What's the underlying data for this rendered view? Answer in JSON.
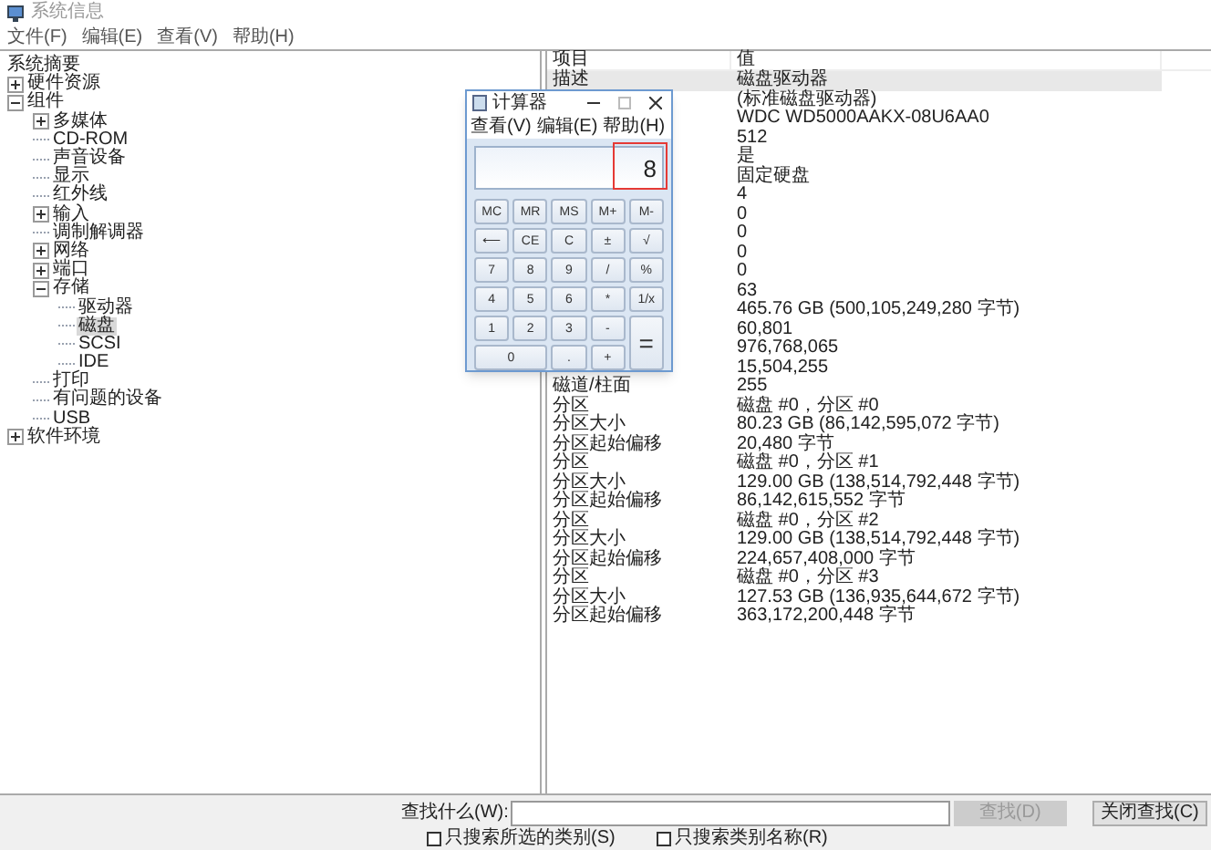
{
  "window": {
    "title": "系统信息"
  },
  "menu": [
    "文件(F)",
    "编辑(E)",
    "查看(V)",
    "帮助(H)"
  ],
  "tree": [
    {
      "label": "系统摘要",
      "selected": false,
      "children": [
        {
          "label": "硬件资源",
          "expanded": false,
          "selected": false
        },
        {
          "label": "组件",
          "expanded": true,
          "selected": false,
          "children": [
            {
              "label": "多媒体",
              "expanded": false,
              "selected": false
            },
            {
              "label": "CD-ROM",
              "selected": false
            },
            {
              "label": "声音设备",
              "selected": false
            },
            {
              "label": "显示",
              "selected": false
            },
            {
              "label": "红外线",
              "selected": false
            },
            {
              "label": "输入",
              "expanded": false,
              "selected": false
            },
            {
              "label": "调制解调器",
              "selected": false
            },
            {
              "label": "网络",
              "expanded": false,
              "selected": false
            },
            {
              "label": "端口",
              "expanded": false,
              "selected": false
            },
            {
              "label": "存储",
              "expanded": true,
              "selected": false,
              "children": [
                {
                  "label": "驱动器",
                  "selected": false
                },
                {
                  "label": "磁盘",
                  "selected": true
                },
                {
                  "label": "SCSI",
                  "selected": false
                },
                {
                  "label": "IDE",
                  "selected": false
                }
              ]
            },
            {
              "label": "打印",
              "selected": false
            },
            {
              "label": "有问题的设备",
              "selected": false
            },
            {
              "label": "USB",
              "selected": false
            }
          ]
        },
        {
          "label": "软件环境",
          "expanded": false,
          "selected": false
        }
      ]
    }
  ],
  "table": {
    "columns": [
      "项目",
      "值"
    ],
    "rows": [
      {
        "item": "描述",
        "value": "磁盘驱动器",
        "selected": true
      },
      {
        "value": "(标准磁盘驱动器)",
        "selected": false
      },
      {
        "value": "WDC WD5000AAKX-08U6AA0",
        "selected": false
      },
      {
        "value": "512",
        "selected": false
      },
      {
        "value": "是",
        "selected": false
      },
      {
        "value": "固定硬盘",
        "selected": false
      },
      {
        "value": "4",
        "selected": false
      },
      {
        "value": "0",
        "selected": false
      },
      {
        "value": "0",
        "selected": false
      },
      {
        "value": "0",
        "selected": false
      },
      {
        "value": "0",
        "selected": false
      },
      {
        "value": "63",
        "selected": false
      },
      {
        "value": "465.76 GB (500,105,249,280 字节)",
        "selected": false
      },
      {
        "value": "60,801",
        "selected": false
      },
      {
        "value": "976,768,065",
        "selected": false
      },
      {
        "value": "15,504,255",
        "selected": false
      },
      {
        "item": "磁道/柱面",
        "value": "255",
        "selected": false
      },
      {
        "item": "分区",
        "value": "磁盘 #0，分区 #0",
        "selected": false
      },
      {
        "item": "分区大小",
        "value": "80.23 GB (86,142,595,072 字节)",
        "selected": false
      },
      {
        "item": "分区起始偏移",
        "value": "20,480 字节",
        "selected": false
      },
      {
        "item": "分区",
        "value": "磁盘 #0，分区 #1",
        "selected": false
      },
      {
        "item": "分区大小",
        "value": "129.00 GB (138,514,792,448 字节)",
        "selected": false
      },
      {
        "item": "分区起始偏移",
        "value": "86,142,615,552 字节",
        "selected": false
      },
      {
        "item": "分区",
        "value": "磁盘 #0，分区 #2",
        "selected": false
      },
      {
        "item": "分区大小",
        "value": "129.00 GB (138,514,792,448 字节)",
        "selected": false
      },
      {
        "item": "分区起始偏移",
        "value": "224,657,408,000 字节",
        "selected": false
      },
      {
        "item": "分区",
        "value": "磁盘 #0，分区 #3",
        "selected": false
      },
      {
        "item": "分区大小",
        "value": "127.53 GB (136,935,644,672 字节)",
        "selected": false
      },
      {
        "item": "分区起始偏移",
        "value": "363,172,200,448 字节",
        "selected": false
      }
    ]
  },
  "calculator": {
    "title": "计算器",
    "menu": [
      "查看(V)",
      "编辑(E)",
      "帮助(H)"
    ],
    "display": "8",
    "keys": [
      {
        "label": "MC",
        "kind": "normal"
      },
      {
        "label": "MR",
        "kind": "normal"
      },
      {
        "label": "MS",
        "kind": "normal"
      },
      {
        "label": "M+",
        "kind": "normal"
      },
      {
        "label": "M-",
        "kind": "normal"
      },
      {
        "label": "⟵",
        "kind": "normal"
      },
      {
        "label": "CE",
        "kind": "normal"
      },
      {
        "label": "C",
        "kind": "normal"
      },
      {
        "label": "±",
        "kind": "normal"
      },
      {
        "label": "√",
        "kind": "normal"
      },
      {
        "label": "7",
        "kind": "normal"
      },
      {
        "label": "8",
        "kind": "normal"
      },
      {
        "label": "9",
        "kind": "normal"
      },
      {
        "label": "/",
        "kind": "normal"
      },
      {
        "label": "%",
        "kind": "normal"
      },
      {
        "label": "4",
        "kind": "normal"
      },
      {
        "label": "5",
        "kind": "normal"
      },
      {
        "label": "6",
        "kind": "normal"
      },
      {
        "label": "*",
        "kind": "normal"
      },
      {
        "label": "1/x",
        "kind": "normal"
      },
      {
        "label": "1",
        "kind": "normal"
      },
      {
        "label": "2",
        "kind": "normal"
      },
      {
        "label": "3",
        "kind": "normal"
      },
      {
        "label": "-",
        "kind": "normal"
      },
      {
        "label": "=",
        "kind": "tall"
      },
      {
        "label": "0",
        "kind": "wide"
      },
      {
        "label": ".",
        "kind": "normal"
      },
      {
        "label": "+",
        "kind": "normal"
      }
    ]
  },
  "find": {
    "label": "查找什么(W):",
    "find_button": {
      "label": "查找(D)",
      "disabled": true
    },
    "close_button": "关闭查找(C)",
    "options": [
      {
        "label": "只搜索所选的类别(S)",
        "checked": false
      },
      {
        "label": "只搜索类别名称(R)",
        "checked": false
      }
    ]
  }
}
